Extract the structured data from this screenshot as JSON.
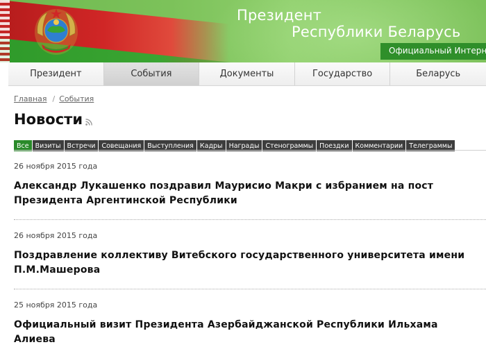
{
  "header": {
    "title_line1": "Президент",
    "title_line2": "Республики Беларусь",
    "subtitle": "Официальный Интерн",
    "colors": {
      "green": "#7cc25a",
      "red": "#c62828",
      "white": "#ffffff"
    }
  },
  "nav": {
    "items": [
      {
        "label": "Президент"
      },
      {
        "label": "События"
      },
      {
        "label": "Документы"
      },
      {
        "label": "Государство"
      },
      {
        "label": "Беларусь"
      }
    ],
    "active_index": 1
  },
  "breadcrumb": {
    "items": [
      {
        "label": "Главная"
      },
      {
        "label": "События"
      }
    ],
    "separator": "/"
  },
  "page": {
    "title": "Новости",
    "rss_icon": "rss-icon"
  },
  "filters": {
    "items": [
      {
        "label": "Все"
      },
      {
        "label": "Визиты"
      },
      {
        "label": "Встречи"
      },
      {
        "label": "Совещания"
      },
      {
        "label": "Выступления"
      },
      {
        "label": "Кадры"
      },
      {
        "label": "Награды"
      },
      {
        "label": "Стенограммы"
      },
      {
        "label": "Поездки"
      },
      {
        "label": "Комментарии"
      },
      {
        "label": "Телеграммы"
      }
    ],
    "active_index": 0,
    "active_color": "#2a8a2a",
    "inactive_color": "#3d3d3d"
  },
  "news": [
    {
      "date": "26 ноября 2015 года",
      "title": "Александр Лукашенко поздравил Маурисио Макри с избранием на пост Президента Аргентинской Республики"
    },
    {
      "date": "26 ноября 2015 года",
      "title": "Поздравление коллективу Витебского государственного университета имени П.М.Машерова"
    },
    {
      "date": "25 ноября 2015 года",
      "title": "Официальный визит Президента Азербайджанской Республики Ильхама Алиева"
    }
  ]
}
